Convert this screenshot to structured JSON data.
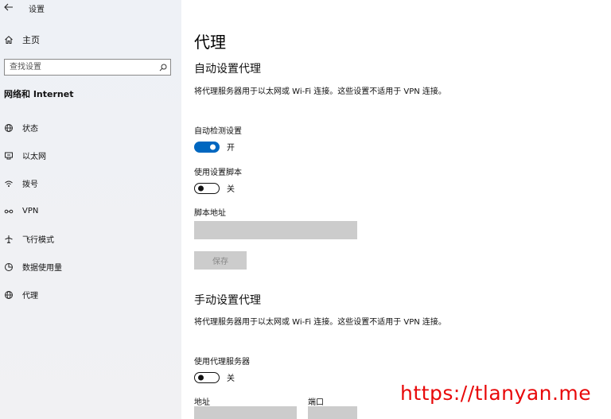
{
  "window": {
    "title": "设置",
    "back_icon": "back-arrow-icon"
  },
  "sidebar": {
    "home": {
      "label": "主页",
      "icon": "home-icon"
    },
    "search": {
      "placeholder": "查找设置",
      "icon": "search-icon"
    },
    "section_title": "网络和 Internet",
    "items": [
      {
        "label": "状态",
        "icon": "status-globe-icon"
      },
      {
        "label": "以太网",
        "icon": "ethernet-icon"
      },
      {
        "label": "拨号",
        "icon": "dialup-icon"
      },
      {
        "label": "VPN",
        "icon": "vpn-icon"
      },
      {
        "label": "飞行模式",
        "icon": "airplane-icon"
      },
      {
        "label": "数据使用量",
        "icon": "data-usage-icon"
      },
      {
        "label": "代理",
        "icon": "proxy-globe-icon"
      }
    ]
  },
  "main": {
    "title": "代理",
    "auto": {
      "heading": "自动设置代理",
      "description": "将代理服务器用于以太网或 Wi-Fi 连接。这些设置不适用于 VPN 连接。",
      "auto_detect": {
        "label": "自动检测设置",
        "state": "开",
        "on": true
      },
      "use_script": {
        "label": "使用设置脚本",
        "state": "关",
        "on": false
      },
      "script_address": {
        "label": "脚本地址",
        "value": ""
      },
      "save_label": "保存"
    },
    "manual": {
      "heading": "手动设置代理",
      "description": "将代理服务器用于以太网或 Wi-Fi 连接。这些设置不适用于 VPN 连接。",
      "use_proxy": {
        "label": "使用代理服务器",
        "state": "关",
        "on": false
      },
      "address": {
        "label": "地址",
        "value": ""
      },
      "port": {
        "label": "端口",
        "value": ""
      }
    }
  },
  "watermark": {
    "text": "https://tlanyan.me",
    "color": "#e8090a"
  },
  "colors": {
    "accent": "#0067c0",
    "sidebar_bg": "#eef1f6",
    "field_bg": "#cccccc"
  }
}
